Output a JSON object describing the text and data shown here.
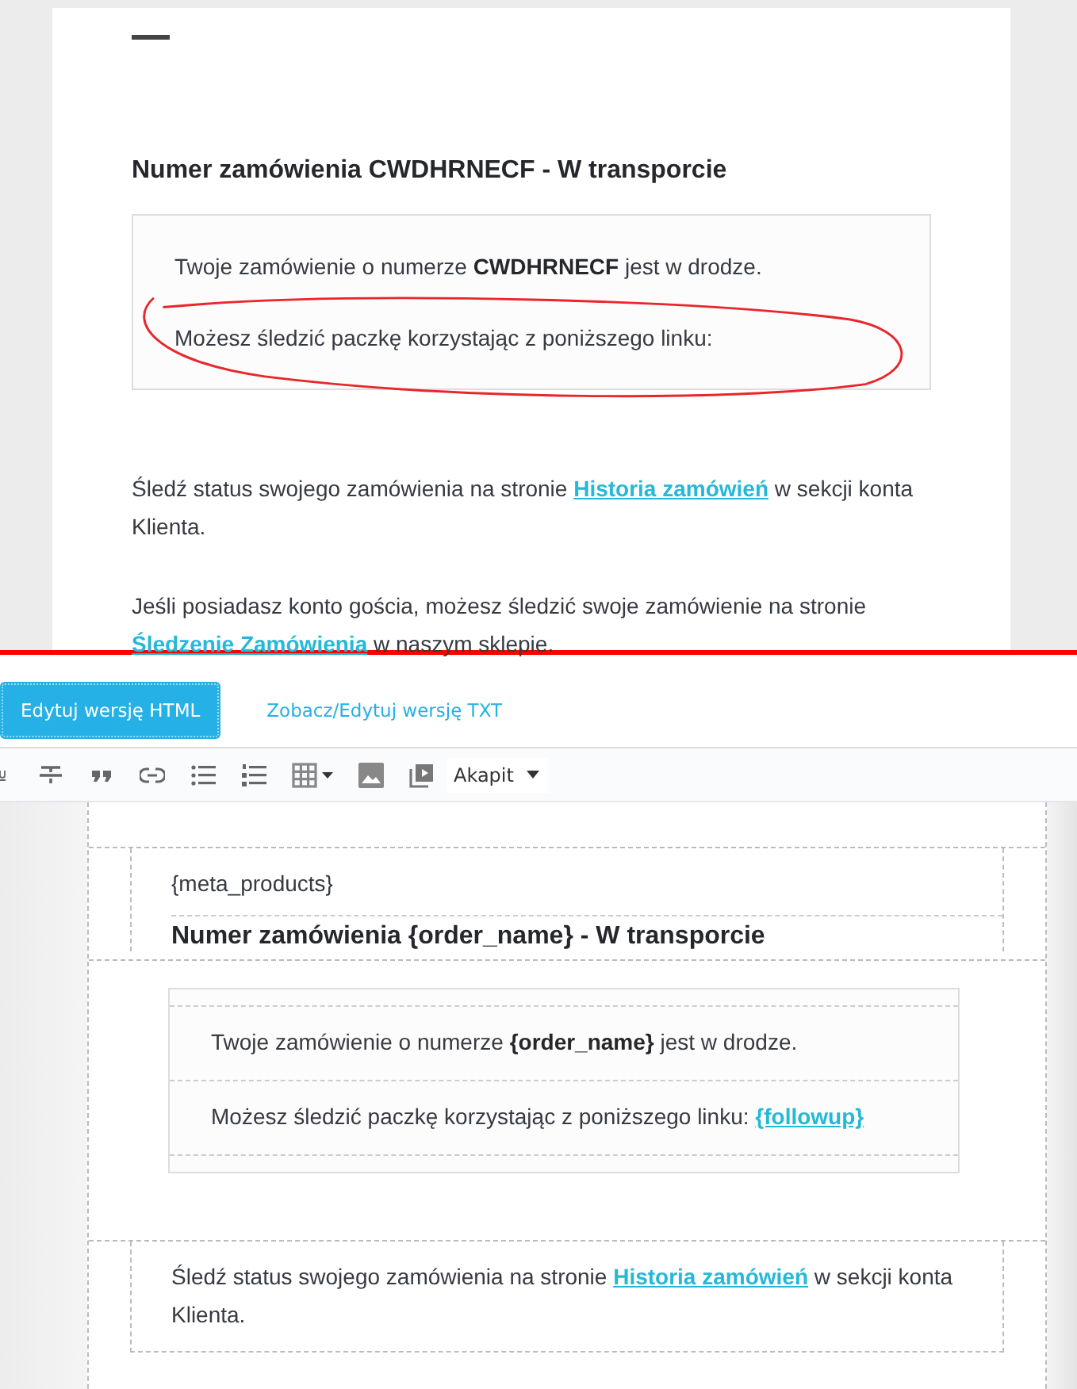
{
  "preview": {
    "heading": "Numer zamówienia CWDHRNECF - W transporcie",
    "box_lines": [
      [
        {
          "kind": "plain",
          "text": "Twoje zamówienie o numerze "
        },
        {
          "kind": "bold",
          "text": "CWDHRNECF"
        },
        {
          "kind": "plain",
          "text": " jest w drodze."
        }
      ],
      [
        {
          "kind": "plain",
          "text": "Możesz śledzić paczkę korzystając z poniższego linku:"
        }
      ]
    ],
    "paragraphs": [
      [
        {
          "kind": "plain",
          "text": "Śledź status swojego zamówienia na stronie "
        },
        {
          "kind": "link",
          "text": "Historia zamówień"
        },
        {
          "kind": "plain",
          "text": " w sekcji konta Klienta."
        }
      ],
      [
        {
          "kind": "plain",
          "text": "Jeśli posiadasz konto gościa, możesz śledzić swoje zamówienie na stronie "
        },
        {
          "kind": "link",
          "text": "Śledzenie Zamówienia"
        },
        {
          "kind": "plain",
          "text": " w naszym sklepie."
        }
      ]
    ]
  },
  "tabs": [
    {
      "label": "Edytuj wersję HTML",
      "selected": true
    },
    {
      "label": "Zobacz/Edytuj wersję TXT",
      "selected": false
    }
  ],
  "toolbar": {
    "format_dropdown": "Akapit"
  },
  "editor": {
    "tag_line": "{meta_products}",
    "heading": "Numer zamówienia {order_name} - W transporcie",
    "box_lines": [
      [
        {
          "kind": "plain",
          "text": "Twoje zamówienie o numerze "
        },
        {
          "kind": "bold",
          "text": "{order_name}"
        },
        {
          "kind": "plain",
          "text": " jest w drodze."
        }
      ],
      [
        {
          "kind": "plain",
          "text": "Możesz śledzić paczkę korzystając z poniższego linku: "
        },
        {
          "kind": "link",
          "text": "{followup}"
        }
      ]
    ],
    "paragraph": [
      {
        "kind": "plain",
        "text": "Śledź status swojego zamówienia na stronie "
      },
      {
        "kind": "link",
        "text": "Historia zamówień"
      },
      {
        "kind": "plain",
        "text": " w sekcji konta Klienta."
      }
    ]
  }
}
